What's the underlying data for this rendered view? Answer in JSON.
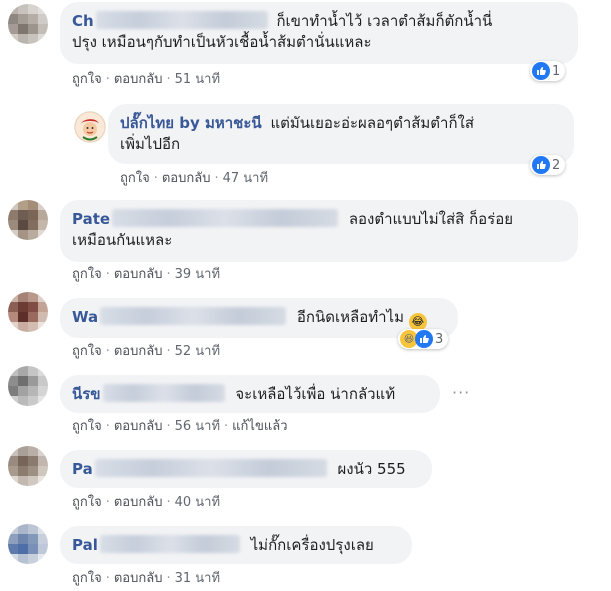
{
  "comments": [
    {
      "author": "Ch",
      "text1": "ก็เขาทำน้ำไว้ เวลาตำส้มก็ตักน้ำนี่",
      "text2": "ปรุง เหมือนๆกับทำเป็นหัวเชื้อน้ำส้มตำนั่นแหละ",
      "like": "ถูกใจ",
      "reply": "ตอบกลับ",
      "time": "51 นาที",
      "reactions": "1"
    },
    {
      "author": "ปลั๊กไทย by มหาชะนี",
      "text1": "แต่มันเยอะอ่ะผลอๆตำส้มตำก็ใส่",
      "text2": "เพิ่มไปอีก",
      "like": "ถูกใจ",
      "reply": "ตอบกลับ",
      "time": "47 นาที",
      "reactions": "2"
    },
    {
      "author": "Pate",
      "text1": "ลองตำแบบไม่ใส่สิ ก็อร่อย",
      "text2": "เหมือนกันแหละ",
      "like": "ถูกใจ",
      "reply": "ตอบกลับ",
      "time": "39 นาที"
    },
    {
      "author": "Wa",
      "text1": "อีกนิดเหลือทำไม",
      "like": "ถูกใจ",
      "reply": "ตอบกลับ",
      "time": "52 นาที",
      "reactions": "3"
    },
    {
      "author": "นีรข",
      "text1": "จะเหลือไว้เพื่อ น่ากลัวแท้",
      "like": "ถูกใจ",
      "reply": "ตอบกลับ",
      "time": "56 นาที",
      "edited": "แก้ไขแล้ว"
    },
    {
      "author": "Pa",
      "text1": "ผงนัว 555",
      "like": "ถูกใจ",
      "reply": "ตอบกลับ",
      "time": "40 นาที"
    },
    {
      "author": "Pal",
      "text1": "ไม่กั๊กเครื่องปรุงเลย",
      "like": "ถูกใจ",
      "reply": "ตอบกลับ",
      "time": "31 นาที"
    }
  ],
  "colors": {
    "author": "#385898",
    "bubble": "#f2f3f5",
    "like_blue": "#2078f4",
    "meta_text": "#606770"
  },
  "icons": [
    "like-icon",
    "haha-icon",
    "laughing-emoji",
    "more-options-icon"
  ]
}
